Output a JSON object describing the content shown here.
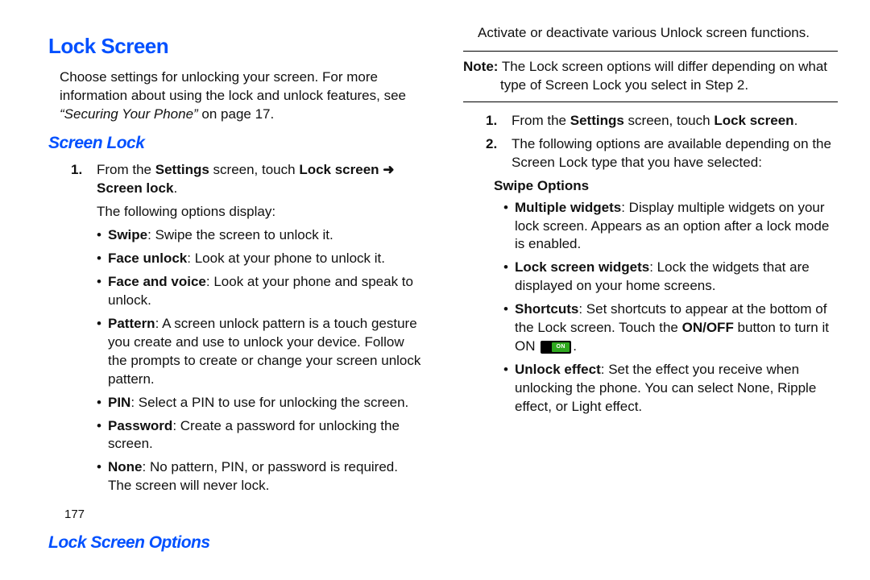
{
  "left": {
    "h1": "Lock Screen",
    "intro1": "Choose settings for unlocking your screen. For more information about using the lock and unlock features, see ",
    "intro_italic": "“Securing Your Phone”",
    "intro2": " on page 17.",
    "h2": "Screen Lock",
    "step1_num": "1.",
    "step1_a": "From the ",
    "step1_b": "Settings",
    "step1_c": " screen, touch ",
    "step1_d": "Lock screen",
    "step1_arrow": " ➜ ",
    "step1_e": "Screen lock",
    "step1_f": ".",
    "following": "The following options display:",
    "opts": {
      "swipe_b": "Swipe",
      "swipe_t": ": Swipe the screen to unlock it.",
      "face_b": "Face unlock",
      "face_t": ": Look at your phone to unlock it.",
      "fv_b": "Face and voice",
      "fv_t": ": Look at your phone and speak to unlock.",
      "pattern_b": "Pattern",
      "pattern_t": ": A screen unlock pattern is a touch gesture you create and use to unlock your device. Follow the prompts to create or change your screen unlock pattern.",
      "pin_b": "PIN",
      "pin_t": ": Select a PIN to use for unlocking the screen.",
      "pwd_b": "Password",
      "pwd_t": ": Create a password for unlocking the screen.",
      "none_b": "None",
      "none_t": ": No pattern, PIN, or password is required. The screen will never lock."
    },
    "page_num": "177"
  },
  "right": {
    "h2": "Lock Screen Options",
    "intro": "Activate or deactivate various Unlock screen functions.",
    "note_label": "Note:",
    "note_body": " The Lock screen options will differ depending on what type of Screen Lock you select in Step 2.",
    "step1_num": "1.",
    "step1_a": "From the ",
    "step1_b": "Settings",
    "step1_c": " screen, touch ",
    "step1_d": "Lock screen",
    "step1_e": ".",
    "step2_num": "2.",
    "step2_t": "The following options are available depending on the Screen Lock type that you have selected:",
    "swipe_hdr": "Swipe Options",
    "opts": {
      "mw_b": "Multiple widgets",
      "mw_t": ": Display multiple widgets on your lock screen. Appears as an option after a lock mode is enabled.",
      "lsw_b": "Lock screen widgets",
      "lsw_t": ": Lock the widgets that are displayed on your home screens.",
      "sc_b": "Shortcuts",
      "sc_t1": ": Set shortcuts to appear at the bottom of the Lock screen. Touch the ",
      "sc_onoff": "ON/OFF",
      "sc_t2": " button to turn it ON ",
      "sc_t3": ".",
      "ue_b": "Unlock effect",
      "ue_t": ": Set the effect you receive when unlocking the phone. You can select None, Ripple effect, or Light effect."
    },
    "toggle_label": "ON"
  }
}
